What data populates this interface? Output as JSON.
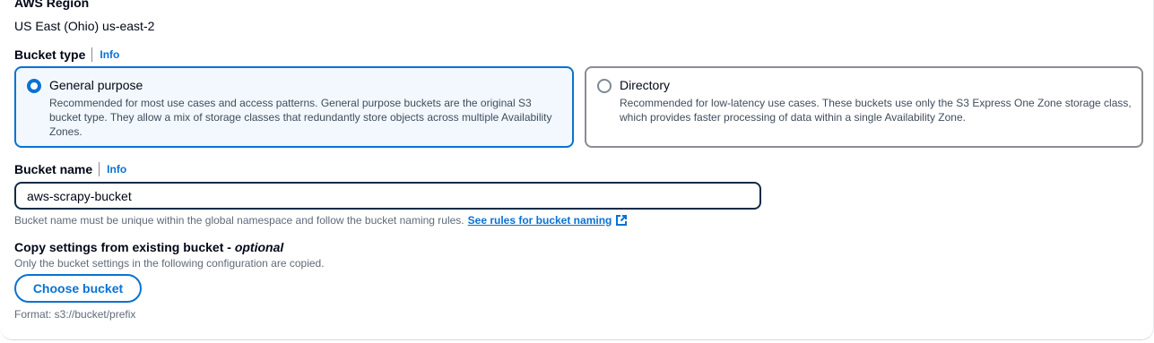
{
  "region": {
    "label": "AWS Region",
    "value": "US East (Ohio) us-east-2"
  },
  "bucket_type": {
    "label": "Bucket type",
    "info": "Info",
    "options": [
      {
        "title": "General purpose",
        "description": "Recommended for most use cases and access patterns. General purpose buckets are the original S3 bucket type. They allow a mix of storage classes that redundantly store objects across multiple Availability Zones.",
        "selected": true
      },
      {
        "title": "Directory",
        "description": "Recommended for low-latency use cases. These buckets use only the S3 Express One Zone storage class, which provides faster processing of data within a single Availability Zone.",
        "selected": false
      }
    ]
  },
  "bucket_name": {
    "label": "Bucket name",
    "info": "Info",
    "value": "aws-scrapy-bucket",
    "constraint": "Bucket name must be unique within the global namespace and follow the bucket naming rules.",
    "rules_link": "See rules for bucket naming"
  },
  "copy_settings": {
    "label": "Copy settings from existing bucket - ",
    "optional": "optional",
    "description": "Only the bucket settings in the following configuration are copied.",
    "button": "Choose bucket",
    "format": "Format: s3://bucket/prefix"
  },
  "colors": {
    "accent": "#0972d3",
    "selected_bg": "#f2f8fd",
    "text": "#000716",
    "secondary_text": "#5f6b7a"
  },
  "icons": {
    "external_link": "external-link-icon"
  }
}
